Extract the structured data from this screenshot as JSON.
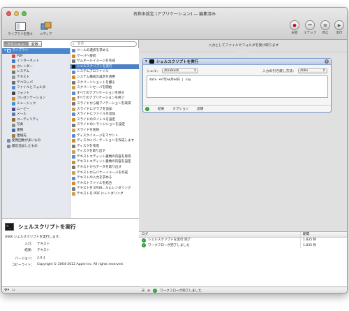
{
  "window": {
    "title": "名称未設定 (アプリケーション) — 編集済み"
  },
  "toolbar": {
    "left": [
      {
        "label": "ライブラリを隠す",
        "icon": "library-icon"
      },
      {
        "label": "メディア",
        "icon": "media-icon"
      }
    ],
    "right": [
      {
        "label": "記録",
        "icon": "record-icon",
        "glyph": "●",
        "color": "#d0021b"
      },
      {
        "label": "ステップ",
        "icon": "step-icon",
        "glyph": "⏭",
        "color": "#555555"
      },
      {
        "label": "停止",
        "icon": "stop-icon",
        "glyph": "■",
        "color": "#888888"
      },
      {
        "label": "実行",
        "icon": "run-icon",
        "glyph": "▶",
        "color": "#555555"
      }
    ]
  },
  "left": {
    "tabs": [
      "アクション",
      "変数"
    ],
    "search_placeholder": "名前",
    "library_header": "ライブラリ",
    "library": [
      {
        "label": "PDF",
        "color": "#d44a3a"
      },
      {
        "label": "インターネット",
        "color": "#3a7bd4"
      },
      {
        "label": "カレンダー",
        "color": "#e06a2a"
      },
      {
        "label": "システム",
        "color": "#777777"
      },
      {
        "label": "テキスト",
        "color": "#999999"
      },
      {
        "label": "デベロッパ",
        "color": "#6a6a6a"
      },
      {
        "label": "ファイルとフォルダ",
        "color": "#5a8ad0"
      },
      {
        "label": "フォント",
        "color": "#444444"
      },
      {
        "label": "プレゼンテーション",
        "color": "#d08a2a"
      },
      {
        "label": "ミュージック",
        "color": "#3a9ad0"
      },
      {
        "label": "ムービー",
        "color": "#4a4a8a"
      },
      {
        "label": "メール",
        "color": "#5a7ab0"
      },
      {
        "label": "ユーティリティ",
        "color": "#8a6a3a"
      },
      {
        "label": "写真",
        "color": "#8a8a8a"
      },
      {
        "label": "書類",
        "color": "#3a6ab0"
      },
      {
        "label": "連絡先",
        "color": "#a07a4a"
      }
    ],
    "extras": [
      "使用回数が多いもの",
      "最近追加したもの"
    ],
    "actions": [
      "ツールの選択を求める",
      "サーバへ接続",
      "サムネールイメージを作成",
      "シェルスクリプトを実行",
      "システムプロファイル",
      "システム構成の設定を適用",
      "スクリーンショットを撮る",
      "スクリーンセーバを開始",
      "すべてのアプリケーションを隠す",
      "すべてのアプリケーションを終了",
      "スライドから縦アノテーションを取得",
      "スライドにグラフを追加",
      "スライドにファイルを追加",
      "スライドのタイトルを設定",
      "スライドのトランジションを設定",
      "スライドを削除",
      "ディスクイメージをマウント",
      "ディスクにパーテーションを作成します",
      "ディスクを作成",
      "ディスクを取り出す",
      "テキストエディット書類の内容を取得",
      "テキストエディット書類の内容を設定",
      "テキストからデータを取り出す",
      "テキストからバナーイメージを作成",
      "テキストの入力を求める",
      "テキストファイルを結合",
      "テキストを EPUB...ルにレンダリング",
      "テキストを PDF にレンダリング"
    ],
    "selected_action": 3
  },
  "description": {
    "title": "シェルスクリプトを実行",
    "subtitle": "UNIX シェルスクリプトを実行します。",
    "rows": [
      {
        "key": "入力：",
        "value": "テキスト"
      },
      {
        "key": "結果：",
        "value": "テキスト"
      },
      {
        "key": "バージョン：",
        "value": "2.0.3"
      },
      {
        "key": "コピーライト：",
        "value": "Copyright © 2004-2012 Apple Inc.  All rights reserved."
      }
    ]
  },
  "workflow": {
    "header": "入力としてファイルやフォルダを受け取ります",
    "action": {
      "title": "シェルスクリプトを実行",
      "shell_label": "シェル：",
      "shell_value": "/bin/bash",
      "input_label": "入力の引き渡し方法：",
      "input_value": "stdin",
      "code": "date +%Y年%m月%d日 | say",
      "footer": [
        "結果",
        "オプション",
        "説明"
      ]
    }
  },
  "log": {
    "col_log": "ログ",
    "col_time": "期間",
    "rows": [
      {
        "text": "シェルスクリプトを実行 完了",
        "time": "1.835 秒"
      },
      {
        "text": "ワークフローが完了しました",
        "time": "1.835 秒"
      }
    ]
  },
  "statusbar": {
    "text": "ワークフローが完了しました"
  }
}
